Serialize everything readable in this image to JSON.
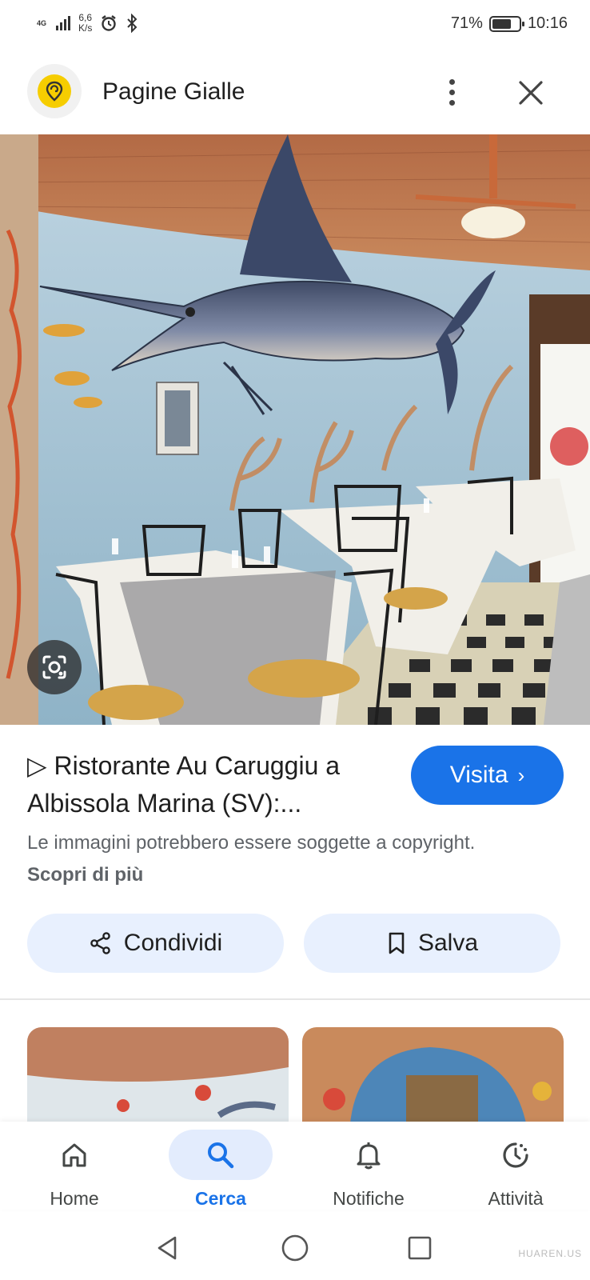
{
  "status_bar": {
    "network": "4G",
    "speed_value": "6,6",
    "speed_unit": "K/s",
    "battery_percent": "71%",
    "battery_level": 0.71,
    "time": "10:16"
  },
  "header": {
    "title": "Pagine Gialle"
  },
  "result": {
    "title": "▷ Ristorante Au Caruggiu a Albissola Marina (SV):...",
    "visit_label": "Visita",
    "visit_chevron": "›",
    "copyright_text": "Le immagini potrebbero essere soggette a copyright.",
    "learn_more": "Scopri di più"
  },
  "actions": {
    "share_label": "Condividi",
    "save_label": "Salva"
  },
  "bottom_nav": {
    "items": [
      {
        "label": "Home",
        "icon": "home-icon"
      },
      {
        "label": "Cerca",
        "icon": "search-icon",
        "active": true
      },
      {
        "label": "Notifiche",
        "icon": "bell-icon"
      },
      {
        "label": "Attività",
        "icon": "activity-icon"
      }
    ]
  },
  "watermark": "HUAREN.US",
  "colors": {
    "accent": "#1a73e8",
    "pill_bg": "#e8f0fe",
    "brand_yellow": "#f6cd00"
  }
}
